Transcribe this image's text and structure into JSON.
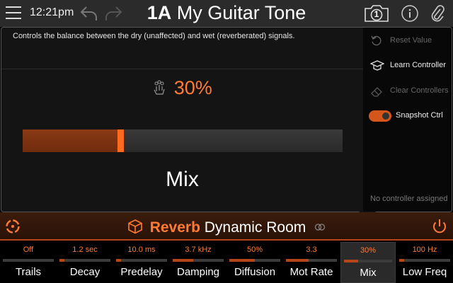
{
  "header": {
    "time": "12:21pm",
    "preset_number": "1A",
    "preset_name": "My Guitar Tone",
    "snapshot_number": "1",
    "icons": [
      "menu-icon",
      "undo-icon",
      "redo-icon",
      "snapshot-icon",
      "info-icon",
      "paperclip-icon"
    ]
  },
  "editor": {
    "description": "Controls the balance between the dry (unaffected) and wet (reverberated) signals.",
    "value": "30%",
    "value_fraction": 0.3,
    "param_name": "Mix",
    "icon": "hand-touch-icon"
  },
  "side_menu": {
    "items": [
      {
        "label": "Reset Value",
        "icon": "reset-icon",
        "enabled": false
      },
      {
        "label": "Learn Controller",
        "icon": "learn-controller-icon",
        "enabled": true
      },
      {
        "label": "Clear Controllers",
        "icon": "eraser-icon",
        "enabled": false
      },
      {
        "label": "Snapshot Ctrl",
        "icon": "toggle",
        "enabled": true,
        "toggle_on": true
      }
    ],
    "footer": "No controller assigned"
  },
  "model": {
    "category": "Reverb",
    "name": "Dynamic Room",
    "icons": [
      "cycle-icon",
      "cube-icon",
      "link-icon",
      "power-icon"
    ]
  },
  "params": [
    {
      "name": "Trails",
      "value": "Off",
      "level": 0.0
    },
    {
      "name": "Decay",
      "value": "1.2 sec",
      "level": 0.1
    },
    {
      "name": "Predelay",
      "value": "10.0 ms",
      "level": 0.1
    },
    {
      "name": "Damping",
      "value": "3.7 kHz",
      "level": 0.4
    },
    {
      "name": "Diffusion",
      "value": "50%",
      "level": 0.5
    },
    {
      "name": "Mot Rate",
      "value": "3.3",
      "level": 0.45
    },
    {
      "name": "Mix",
      "value": "30%",
      "level": 0.3,
      "selected": true
    },
    {
      "name": "Low Freq",
      "value": "100 Hz",
      "level": 0.1
    }
  ],
  "colors": {
    "accent": "#ff7a33",
    "accent_dark": "#b5461a",
    "panel_bg": "#141414",
    "topbar_bg": "#2b2b2b"
  }
}
